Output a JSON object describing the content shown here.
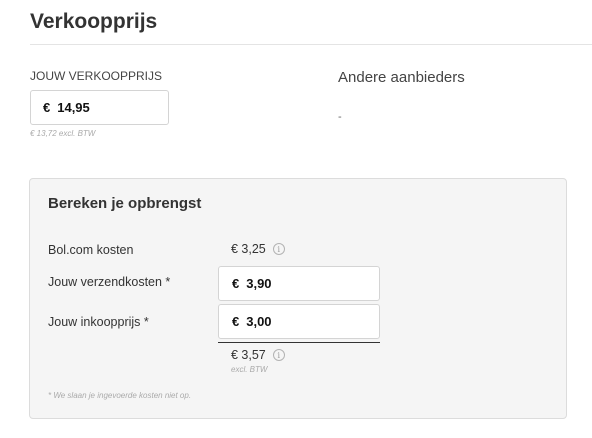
{
  "header": {
    "title": "Verkoopprijs"
  },
  "pricing": {
    "label": "JOUW VERKOOPPRIJS",
    "currency": "€",
    "price": "14,95",
    "excl_note": "€ 13,72 excl. BTW"
  },
  "other_sellers": {
    "title": "Andere aanbieders",
    "value": "-"
  },
  "calculator": {
    "title": "Bereken je opbrengst",
    "bol_costs": {
      "label": "Bol.com kosten",
      "value": "€ 3,25",
      "icon": "info-icon"
    },
    "shipping": {
      "label": "Jouw verzendkosten *",
      "currency": "€",
      "value": "3,90"
    },
    "purchase": {
      "label": "Jouw inkoopprijs *",
      "currency": "€",
      "value": "3,00"
    },
    "result": {
      "value": "€ 3,57",
      "icon": "info-icon",
      "excl_note": "excl. BTW"
    },
    "footnote": "* We slaan je ingevoerde kosten niet op."
  }
}
